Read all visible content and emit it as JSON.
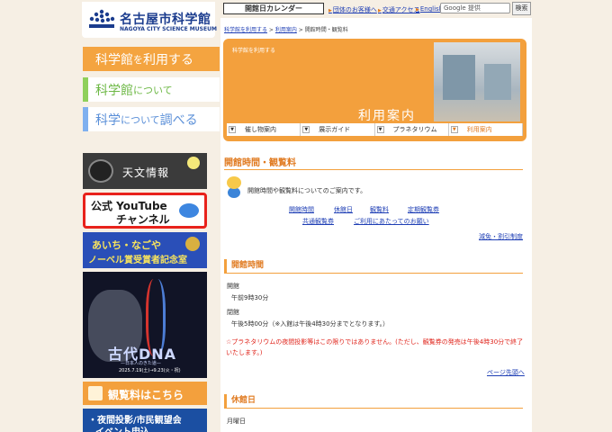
{
  "logo": {
    "ja": "名古屋市科学館",
    "en": "NAGOYA CITY SCIENCE MUSEUM"
  },
  "left_nav": [
    {
      "label_a": "科学館",
      "label_b": "を",
      "label_c": "利用する"
    },
    {
      "label_a": "科学館",
      "label_b": "について",
      "label_c": ""
    },
    {
      "label_a": "科学",
      "label_b": "について",
      "label_c": "調べる"
    }
  ],
  "banners": {
    "astro": "天文情報",
    "youtube_1": "公式 YouTube",
    "youtube_2": "チャンネル",
    "nobel_1": "あいち・なごや",
    "nobel_2": "ノーベル賞受賞者記念室",
    "dna_title": "古代DNA",
    "dna_sub": "—日本人のきた道—",
    "dna_date": "2025.7.19(土)→9.23(火・祝)",
    "fee": "観覧料はこちら",
    "event_1": "・夜間投影/市民観望会",
    "event_2": "イベント申込"
  },
  "topbar": {
    "calendar": "開館日カレンダー",
    "links": [
      "団体のお客様へ",
      "交通アクセス",
      "English"
    ],
    "search_placeholder": "Google 提供",
    "search_button": "検索"
  },
  "breadcrumb": {
    "items": [
      "科学館を利用する",
      "利用案内",
      "開館時間・観覧料"
    ],
    "sep": " > "
  },
  "hero": {
    "label": "科学館を利用する",
    "title": "利用案内",
    "tabs": [
      "催し物案内",
      "展示ガイド",
      "プラネタリウム",
      "利用案内"
    ]
  },
  "page": {
    "title": "開館時間・観覧料",
    "intro": "開館時間や観覧料についてのご案内です。",
    "links": [
      "開館時間",
      "休館日",
      "観覧料",
      "定期観覧券",
      "共通観覧券",
      "ご利用にあたってのお願い"
    ],
    "discount_link": "減免・割引制度",
    "section1": "開館時間",
    "open_label": "開館",
    "open_time": "午前9時30分",
    "close_label": "閉館",
    "close_time": "午後5時00分（※入館は午後4時30分までとなります。）",
    "note": "☆プラネタリウムの夜間投影等はこの限りではありません。(ただし、観覧券の発売は午後4時30分で終了いたします。)",
    "back_top": "ページ先頭へ",
    "section2": "休館日",
    "holiday": "月曜日"
  },
  "colors": {
    "accent": "#f3a03d",
    "link": "#1f3fb5",
    "note": "#e0241b",
    "nav_green": "#6db845",
    "nav_blue": "#5a8fd8"
  }
}
